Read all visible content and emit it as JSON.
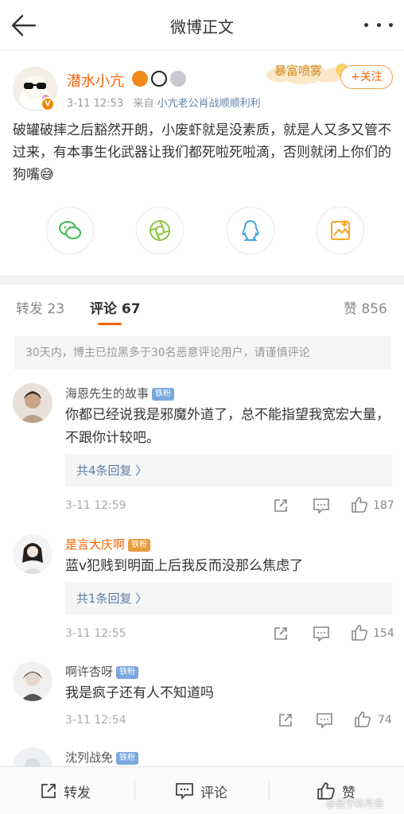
{
  "nav": {
    "title": "微博正文"
  },
  "post": {
    "author": "潜水小亢",
    "time": "3-11 12:53",
    "source_prefix": "来自",
    "source": "小亢老公肖战顺顺利利",
    "banner_text": "暴富喷雾",
    "follow_label": "+关注",
    "text": "破罐破摔之后豁然开朗，小废虾就是没素质，就是人又多又管不过来，有本事生化武器让我们都死啦死啦滴，否则就闭上你们的狗嘴😅",
    "share_icons": [
      "wechat-icon",
      "moments-icon",
      "qq-icon",
      "save-image-icon"
    ]
  },
  "tabs": {
    "repost_label": "转发",
    "repost_count": "23",
    "comment_label": "评论",
    "comment_count": "67",
    "like_label": "赞",
    "like_count": "856"
  },
  "notice": "30天内，博主已拉黑多于30名恶意评论用户，请谨慎评论",
  "comments": [
    {
      "name": "海恩先生的故事",
      "badge": "铁粉",
      "text": "你都已经说我是邪魔外道了，总不能指望我宽宏大量，不跟你计较吧。",
      "replies": "共4条回复 〉",
      "time": "3-11 12:59",
      "likes": "187"
    },
    {
      "name": "是言大庆啊",
      "badge": "铁粉",
      "text": "蓝v犯贱到明面上后我反而没那么焦虑了",
      "replies": "共1条回复 〉",
      "time": "3-11 12:55",
      "likes": "154"
    },
    {
      "name": "啊许杏呀",
      "badge": "铁粉",
      "text": "我是疯子还有人不知道吗",
      "time": "3-11 12:54",
      "likes": "74"
    },
    {
      "name": "沈列战免",
      "badge": "铁粉"
    }
  ],
  "bottom": {
    "repost": "转发",
    "comment": "评论",
    "like": "赞"
  },
  "watermark": "@星予新月叁",
  "colors": {
    "accent": "#f56300",
    "link": "#5f7fa8"
  }
}
